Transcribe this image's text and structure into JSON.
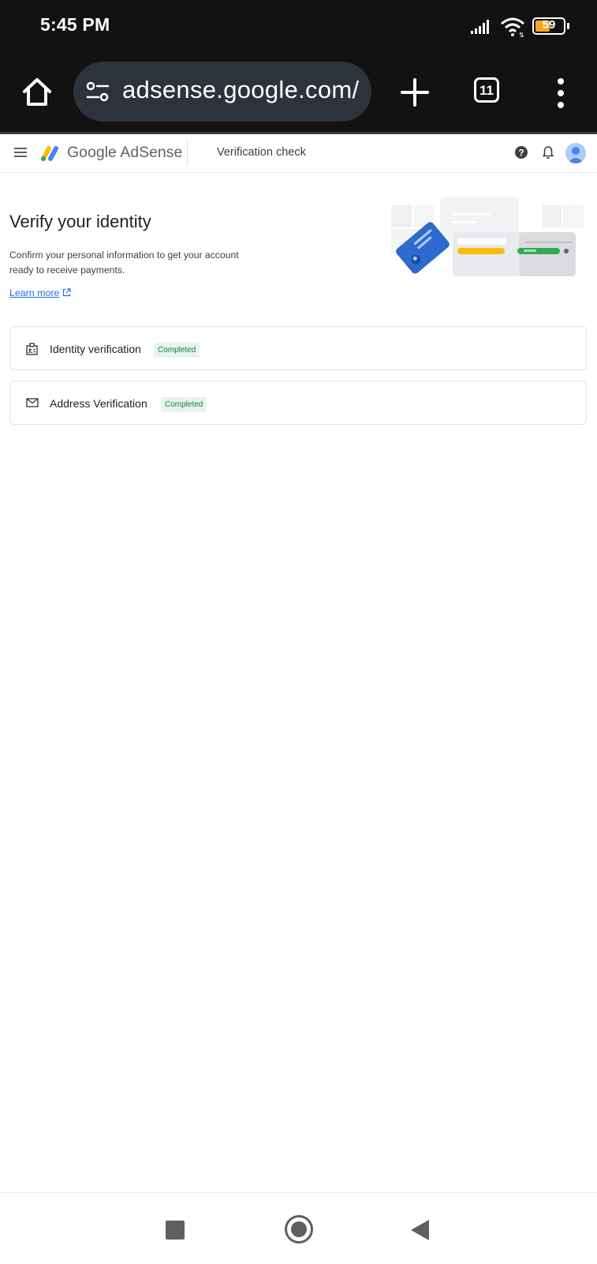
{
  "status_bar": {
    "time": "5:45 PM",
    "battery": "59",
    "battery_level_percent": 59,
    "icons": [
      "signal-icon",
      "wifi-icon",
      "battery-icon"
    ]
  },
  "browser": {
    "url": "adsense.google.com/",
    "tab_count": "11",
    "icons": [
      "home-icon",
      "site-settings-icon",
      "new-tab-icon",
      "tab-switcher-icon",
      "more-vert-icon"
    ]
  },
  "app_bar": {
    "brand": "Google AdSense",
    "section": "Verification check",
    "icons": [
      "menu-icon",
      "adsense-logo-icon",
      "help-icon",
      "notifications-icon",
      "avatar-icon"
    ]
  },
  "main": {
    "heading": "Verify your identity",
    "description": "Confirm your personal information to get your account ready to receive payments.",
    "learn_more": "Learn more",
    "steps": [
      {
        "label": "Identity verification",
        "status": "Completed",
        "icon": "id-badge-icon"
      },
      {
        "label": "Address Verification",
        "status": "Completed",
        "icon": "mail-icon"
      }
    ]
  },
  "colors": {
    "accent": "#1a73e8",
    "status_bg": "#e6f4ea",
    "status_text": "#188038",
    "browser_bg": "#121212",
    "url_box": "#2d333b"
  },
  "nav_bar": {
    "icons": [
      "recents-icon",
      "home-button-icon",
      "back-icon"
    ]
  }
}
